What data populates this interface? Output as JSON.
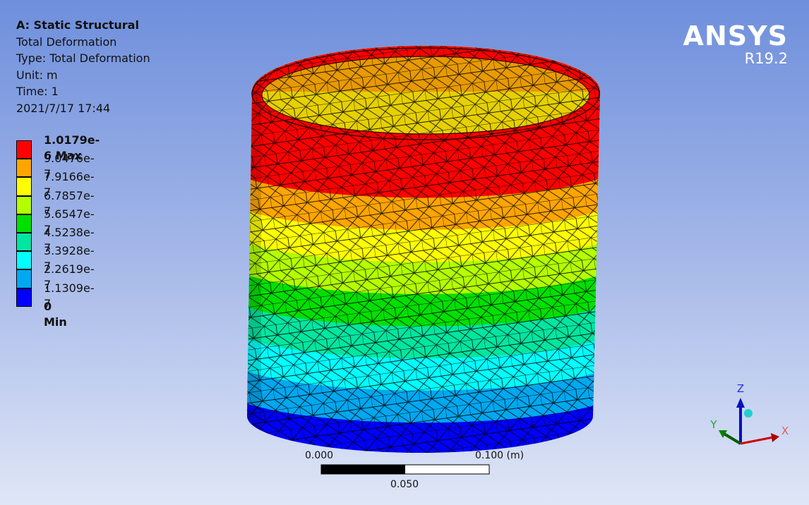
{
  "info": {
    "title": "A: Static Structural",
    "result": "Total Deformation",
    "type": "Type: Total Deformation",
    "unit": "Unit: m",
    "time": "Time: 1",
    "timestamp": "2021/7/17 17:44"
  },
  "legend": [
    {
      "label": "1.0179e-6 Max",
      "color": "#ff0000",
      "bold": true
    },
    {
      "label": "9.0476e-7",
      "color": "#ffa500"
    },
    {
      "label": "7.9166e-7",
      "color": "#ffff00"
    },
    {
      "label": "6.7857e-7",
      "color": "#b4ff00"
    },
    {
      "label": "5.6547e-7",
      "color": "#00e000"
    },
    {
      "label": "4.5238e-7",
      "color": "#00e6a0"
    },
    {
      "label": "3.3928e-7",
      "color": "#00ffff"
    },
    {
      "label": "2.2619e-7",
      "color": "#00a8f0"
    },
    {
      "label": "1.1309e-7",
      "color": "#0000ff"
    },
    {
      "label": "0 Min",
      "bold": true
    }
  ],
  "logo": {
    "name": "ANSYS",
    "version": "R19.2"
  },
  "scale": {
    "left": "0.000",
    "right": "0.100 (m)",
    "mid": "0.050"
  },
  "triad": {
    "x": "X",
    "y": "Y",
    "z": "Z"
  }
}
